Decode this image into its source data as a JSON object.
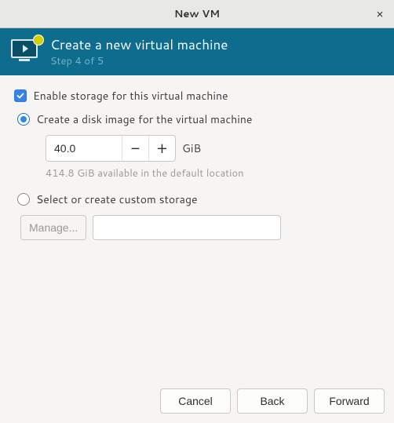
{
  "window": {
    "title": "New VM",
    "close": "×"
  },
  "header": {
    "title": "Create a new virtual machine",
    "step": "Step 4 of 5"
  },
  "storage": {
    "enable_label": "Enable storage for this virtual machine",
    "enable_checked": true,
    "create_image_label": "Create a disk image for the virtual machine",
    "create_image_selected": true,
    "size_value": "40.0",
    "size_unit": "GiB",
    "available_hint": "414.8 GiB available in the default location",
    "custom_label": "Select or create custom storage",
    "custom_selected": false,
    "manage_label": "Manage...",
    "path_value": ""
  },
  "buttons": {
    "cancel": "Cancel",
    "back": "Back",
    "forward": "Forward"
  }
}
